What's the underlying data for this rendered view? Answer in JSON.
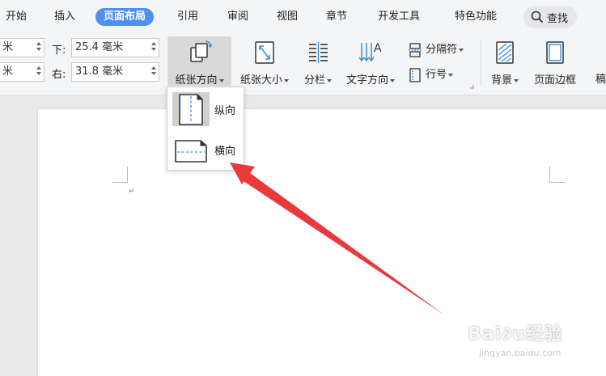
{
  "menu": {
    "items": [
      "开始",
      "插入",
      "页面布局",
      "引用",
      "审阅",
      "视图",
      "章节",
      "开发工具",
      "特色功能"
    ],
    "active": "页面布局",
    "search_label": "查找"
  },
  "margins": {
    "unit_left_top": "米",
    "unit_left_bottom": "米",
    "bottom_label": "下:",
    "bottom_value": "25.4 毫米",
    "right_label": "右:",
    "right_value": "31.8 毫米"
  },
  "toolbar": {
    "orientation": "纸张方向",
    "size": "纸张大小",
    "columns": "分栏",
    "text_direction": "文字方向",
    "separator": "分隔符",
    "line_numbers": "行号",
    "background": "背景",
    "page_border": "页面边框",
    "truncated": "稿"
  },
  "dropdown": {
    "portrait": "纵向",
    "landscape": "横向"
  },
  "watermark": {
    "brand": "Bai∂u经验",
    "url": "jingyan.baidu.com"
  },
  "colors": {
    "accent": "#4e8ff2",
    "arrow": "#e8393b",
    "dashed": "#3d8fd8"
  }
}
